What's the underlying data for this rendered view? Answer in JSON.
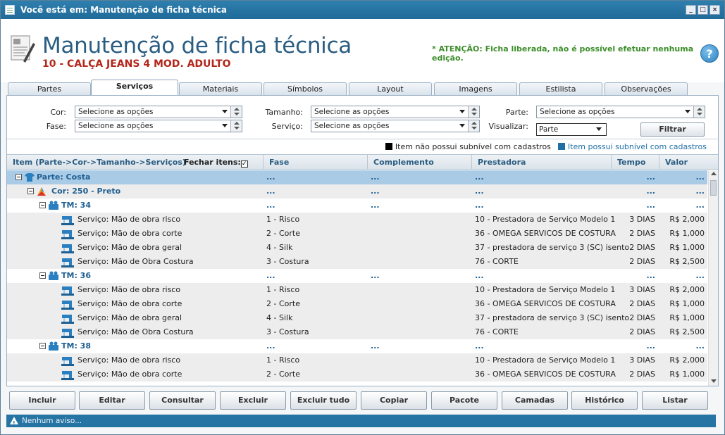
{
  "window": {
    "title": "Você está em: Manutenção de ficha técnica",
    "buttons": [
      "_",
      "□",
      "×"
    ]
  },
  "header": {
    "title": "Manutenção de ficha técnica",
    "subtitle": "10 - CALÇA JEANS 4 MOD. ADULTO",
    "attention": "* ATENÇÃO: Ficha liberada, não é possível efetuar nenhuma edição.",
    "help": "?"
  },
  "tabs": [
    "Partes",
    "Serviços",
    "Materiais",
    "Símbolos",
    "Layout",
    "Imagens",
    "Estilista",
    "Observações"
  ],
  "active_tab": "Serviços",
  "filters": {
    "cor_label": "Cor:",
    "fase_label": "Fase:",
    "tamanho_label": "Tamanho:",
    "servico_label": "Serviço:",
    "parte_label": "Parte:",
    "visualizar_label": "Visualizar:",
    "placeholder": "Selecione as opções",
    "visualizar_value": "Parte",
    "filter_button": "Filtrar"
  },
  "legend": {
    "no_sub": "Item não possui subnível com cadastros",
    "has_sub": "Item possui subnível com cadastros",
    "no_sub_color": "#000000",
    "has_sub_color": "#1f6fa5"
  },
  "columns": {
    "item": "Item (Parte->Cor->Tamanho->Serviços)",
    "fechar": "Fechar itens:",
    "fechar_checked": "✓",
    "fase": "Fase",
    "complemento": "Complemento",
    "prestadora": "Prestadora",
    "tempo": "Tempo",
    "valor": "Valor"
  },
  "rows": [
    {
      "type": "parte",
      "label": "Parte: Costa",
      "fase": "...",
      "complemento": "...",
      "prestadora": "...",
      "tempo": "...",
      "valor": "..."
    },
    {
      "type": "cor",
      "label": "Cor: 250 - Preto",
      "fase": "...",
      "complemento": "...",
      "prestadora": "...",
      "tempo": "...",
      "valor": "..."
    },
    {
      "type": "tm",
      "label": "TM: 34",
      "fase": "...",
      "complemento": "...",
      "prestadora": "...",
      "tempo": "...",
      "valor": "..."
    },
    {
      "type": "svc",
      "label": "Serviço: Mão de obra risco",
      "fase": "1 - Risco",
      "complemento": "",
      "prestadora": "10 - Prestadora de Serviço Modelo 1",
      "tempo": "3 DIAS",
      "valor": "R$ 2,000"
    },
    {
      "type": "svc",
      "label": "Serviço: Mão de obra corte",
      "fase": "2 - Corte",
      "complemento": "",
      "prestadora": "36 - OMEGA SERVICOS DE COSTURA",
      "tempo": "2 DIAS",
      "valor": "R$ 1,000"
    },
    {
      "type": "svc",
      "label": "Serviço: Mão de obra geral",
      "fase": "4 - Silk",
      "complemento": "",
      "prestadora": "37 - prestadora de serviço 3 (SC) isento",
      "tempo": "2 DIAS",
      "valor": "R$ 1,000"
    },
    {
      "type": "svc",
      "label": "Serviço: Mão de Obra Costura",
      "fase": "3 - Costura",
      "complemento": "",
      "prestadora": "76 - CORTE",
      "tempo": "2 DIAS",
      "valor": "R$ 2,500"
    },
    {
      "type": "tm",
      "label": "TM: 36",
      "fase": "...",
      "complemento": "...",
      "prestadora": "...",
      "tempo": "...",
      "valor": "..."
    },
    {
      "type": "svc",
      "label": "Serviço: Mão de obra risco",
      "fase": "1 - Risco",
      "complemento": "",
      "prestadora": "10 - Prestadora de Serviço Modelo 1",
      "tempo": "3 DIAS",
      "valor": "R$ 2,000"
    },
    {
      "type": "svc",
      "label": "Serviço: Mão de obra corte",
      "fase": "2 - Corte",
      "complemento": "",
      "prestadora": "36 - OMEGA SERVICOS DE COSTURA",
      "tempo": "2 DIAS",
      "valor": "R$ 1,000"
    },
    {
      "type": "svc",
      "label": "Serviço: Mão de obra geral",
      "fase": "4 - Silk",
      "complemento": "",
      "prestadora": "37 - prestadora de serviço 3 (SC) isento",
      "tempo": "2 DIAS",
      "valor": "R$ 1,000"
    },
    {
      "type": "svc",
      "label": "Serviço: Mão de Obra Costura",
      "fase": "3 - Costura",
      "complemento": "",
      "prestadora": "76 - CORTE",
      "tempo": "2 DIAS",
      "valor": "R$ 2,500"
    },
    {
      "type": "tm",
      "label": "TM: 38",
      "fase": "...",
      "complemento": "...",
      "prestadora": "...",
      "tempo": "...",
      "valor": "..."
    },
    {
      "type": "svc",
      "label": "Serviço: Mão de obra risco",
      "fase": "1 - Risco",
      "complemento": "",
      "prestadora": "10 - Prestadora de Serviço Modelo 1",
      "tempo": "3 DIAS",
      "valor": "R$ 2,000"
    },
    {
      "type": "svc",
      "label": "Serviço: Mão de obra corte",
      "fase": "2 - Corte",
      "complemento": "",
      "prestadora": "36 - OMEGA SERVICOS DE COSTURA",
      "tempo": "2 DIAS",
      "valor": "R$ 1,000"
    }
  ],
  "toolbar": [
    "Incluir",
    "Editar",
    "Consultar",
    "Excluir",
    "Excluir tudo",
    "Copiar",
    "Pacote",
    "Camadas",
    "Histórico",
    "Listar"
  ],
  "status": {
    "text": "Nenhum aviso...",
    "icon": "warning-icon"
  }
}
